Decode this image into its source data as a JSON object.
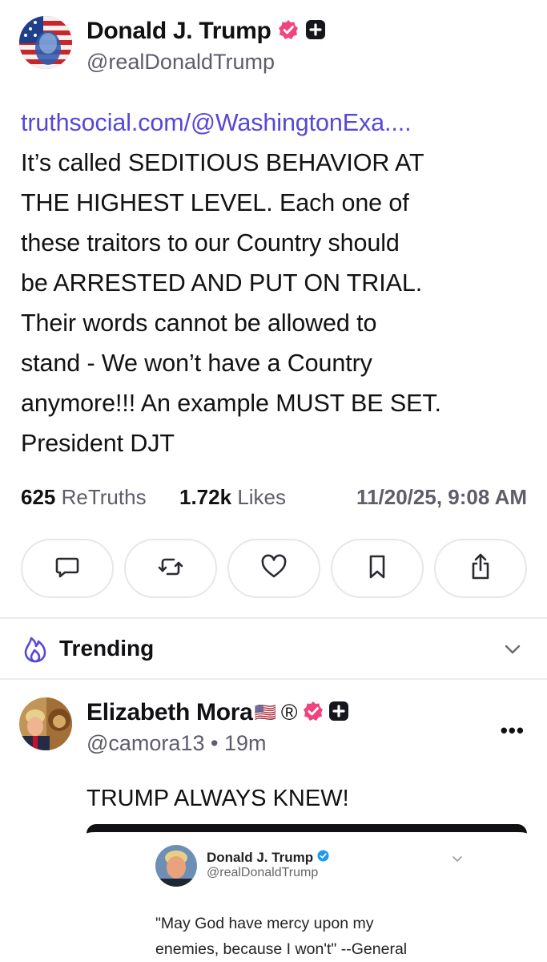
{
  "post": {
    "display_name": "Donald J. Trump",
    "handle": "@realDonaldTrump",
    "link_text": "truthsocial.com/@WashingtonExa....",
    "body_lines": [
      "It’s called SEDITIOUS BEHAVIOR AT",
      "THE HIGHEST LEVEL. Each one of",
      "these traitors to our Country should",
      "be ARRESTED AND PUT ON TRIAL.",
      "Their words cannot be allowed to",
      "stand - We won’t have a Country",
      "anymore!!! An example MUST BE SET.",
      "President DJT"
    ],
    "retruths_count": "625",
    "retruths_label": "ReTruths",
    "likes_count": "1.72k",
    "likes_label": "Likes",
    "timestamp": "11/20/25, 9:08 AM"
  },
  "actions": [
    {
      "icon": "comment-icon"
    },
    {
      "icon": "retruth-icon"
    },
    {
      "icon": "heart-icon"
    },
    {
      "icon": "bookmark-icon"
    },
    {
      "icon": "share-icon"
    }
  ],
  "trending": {
    "label": "Trending",
    "icon": "flame-icon"
  },
  "reply": {
    "display_name": "Elizabeth Mora",
    "flag": "🇺🇸",
    "registered": "®",
    "handle": "@camora13",
    "separator": "•",
    "time_ago": "19m",
    "text": "TRUMP ALWAYS KNEW!",
    "more": "•••"
  },
  "embed": {
    "name": "Donald J. Trump",
    "handle": "@realDonaldTrump",
    "quote_line1": "\"May God have mercy upon my",
    "quote_line2": "enemies, because I won't\" --General"
  },
  "colors": {
    "link": "#5548d9",
    "verified": "#f0447e",
    "accent": "#5548d9",
    "muted": "#5d5d6b"
  }
}
